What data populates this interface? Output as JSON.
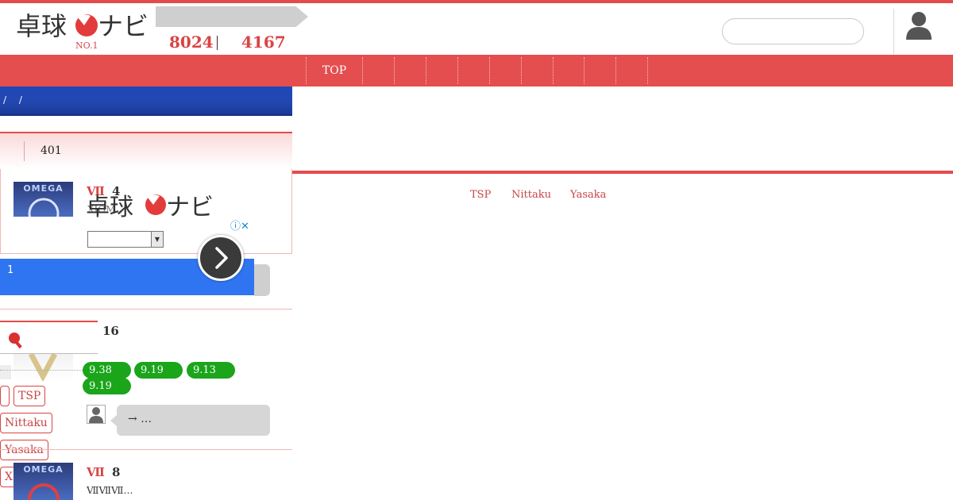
{
  "header": {
    "logo_text": "卓球ナビ",
    "logo_sub": "NO.1",
    "stats": [
      "8024",
      "4167"
    ],
    "search_placeholder": ""
  },
  "nav": {
    "items": [
      "TOP",
      "",
      "",
      "",
      "",
      "",
      "",
      "",
      "",
      "",
      ""
    ]
  },
  "breadcrumb": "/ /",
  "list": {
    "count": "401",
    "items": [
      {
        "rank_label": "Ⅶ",
        "rank_num": "4",
        "thumb_label": "OMEGA",
        "subtitle": "XIOM"
      },
      {
        "rank_num": "16",
        "scores": [
          "9.38",
          "9.19",
          "9.13",
          "9.19"
        ],
        "comment": "→ …"
      },
      {
        "rank_label": "Ⅶ",
        "rank_num": "8",
        "thumb_label": "OMEGA",
        "subtitle": "ⅦⅦⅦ…"
      }
    ]
  },
  "ad": {
    "logo_text": "卓球ナビ",
    "info_icon": "ⓘ✕",
    "banner_text": "1"
  },
  "brand_tags": [
    "",
    "TSP",
    "Nittaku",
    "Yasaka",
    "XIOM"
  ],
  "right_links": [
    "TSP",
    "Nittaku",
    "Yasaka"
  ],
  "colors": {
    "accent": "#e44b4b",
    "nav_bg": "#e44e4e",
    "blue_bar": "#2347b0",
    "score_green": "#1aa51a",
    "ad_blue": "#2f74f0"
  }
}
